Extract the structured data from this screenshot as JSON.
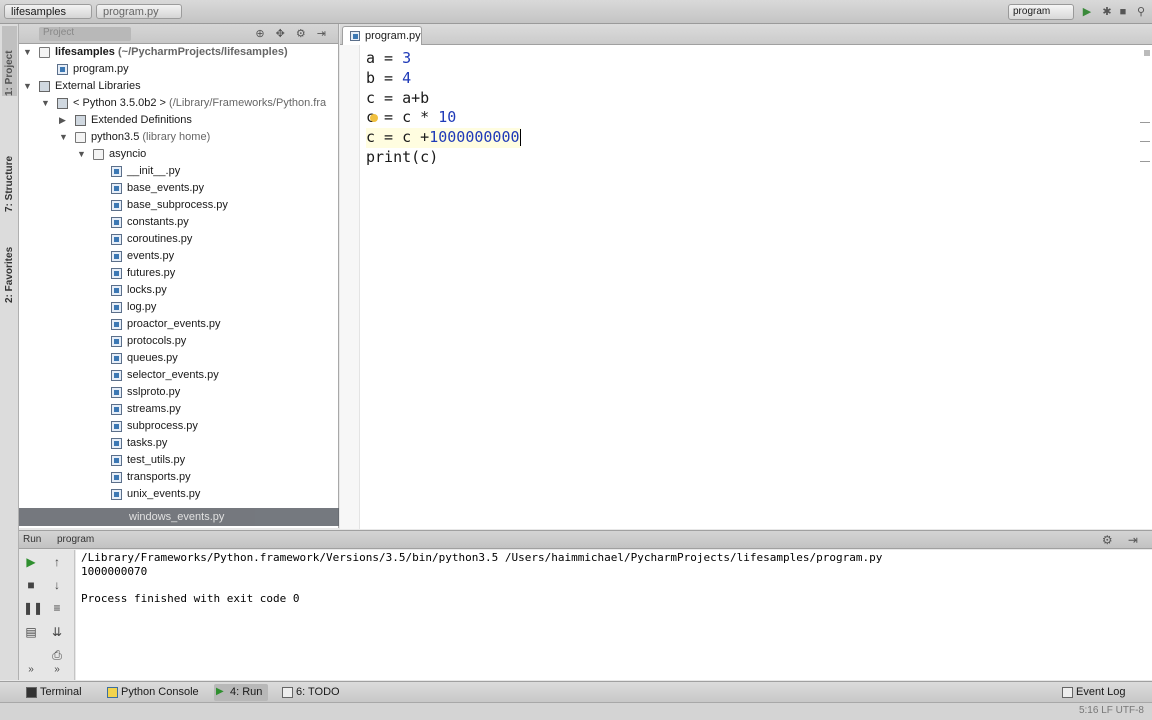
{
  "navbar": {
    "crumb1": "lifesamples",
    "crumb2": "program.py",
    "run_config": "program"
  },
  "left_stripe": {
    "project": "1: Project",
    "structure": "7: Structure",
    "favorites": "2: Favorites"
  },
  "project_panel": {
    "title": "Project",
    "tree": [
      {
        "label": "lifesamples",
        "hint": " (~/PycharmProjects/lifesamples)",
        "bold": true,
        "icon": "folder",
        "depth": 0,
        "arrow": "down"
      },
      {
        "label": "program.py",
        "hint": "",
        "bold": false,
        "icon": "file",
        "depth": 1,
        "arrow": ""
      },
      {
        "label": "External Libraries",
        "hint": "",
        "bold": false,
        "icon": "library",
        "depth": 0,
        "arrow": "down"
      },
      {
        "label": "< Python 3.5.0b2 >",
        "hint": " (/Library/Frameworks/Python.fra",
        "bold": false,
        "icon": "library",
        "depth": 1,
        "arrow": "down"
      },
      {
        "label": "Extended Definitions",
        "hint": "",
        "bold": false,
        "icon": "library",
        "depth": 2,
        "arrow": "right"
      },
      {
        "label": "python3.5",
        "hint": " (library home)",
        "bold": false,
        "icon": "folder",
        "depth": 2,
        "arrow": "down"
      },
      {
        "label": "asyncio",
        "hint": "",
        "bold": false,
        "icon": "folder",
        "depth": 3,
        "arrow": "down"
      },
      {
        "label": "__init__.py",
        "hint": "",
        "bold": false,
        "icon": "file",
        "depth": 4,
        "arrow": ""
      },
      {
        "label": "base_events.py",
        "hint": "",
        "bold": false,
        "icon": "file",
        "depth": 4,
        "arrow": ""
      },
      {
        "label": "base_subprocess.py",
        "hint": "",
        "bold": false,
        "icon": "file",
        "depth": 4,
        "arrow": ""
      },
      {
        "label": "constants.py",
        "hint": "",
        "bold": false,
        "icon": "file",
        "depth": 4,
        "arrow": ""
      },
      {
        "label": "coroutines.py",
        "hint": "",
        "bold": false,
        "icon": "file",
        "depth": 4,
        "arrow": ""
      },
      {
        "label": "events.py",
        "hint": "",
        "bold": false,
        "icon": "file",
        "depth": 4,
        "arrow": ""
      },
      {
        "label": "futures.py",
        "hint": "",
        "bold": false,
        "icon": "file",
        "depth": 4,
        "arrow": ""
      },
      {
        "label": "locks.py",
        "hint": "",
        "bold": false,
        "icon": "file",
        "depth": 4,
        "arrow": ""
      },
      {
        "label": "log.py",
        "hint": "",
        "bold": false,
        "icon": "file",
        "depth": 4,
        "arrow": ""
      },
      {
        "label": "proactor_events.py",
        "hint": "",
        "bold": false,
        "icon": "file",
        "depth": 4,
        "arrow": ""
      },
      {
        "label": "protocols.py",
        "hint": "",
        "bold": false,
        "icon": "file",
        "depth": 4,
        "arrow": ""
      },
      {
        "label": "queues.py",
        "hint": "",
        "bold": false,
        "icon": "file",
        "depth": 4,
        "arrow": ""
      },
      {
        "label": "selector_events.py",
        "hint": "",
        "bold": false,
        "icon": "file",
        "depth": 4,
        "arrow": ""
      },
      {
        "label": "sslproto.py",
        "hint": "",
        "bold": false,
        "icon": "file",
        "depth": 4,
        "arrow": ""
      },
      {
        "label": "streams.py",
        "hint": "",
        "bold": false,
        "icon": "file",
        "depth": 4,
        "arrow": ""
      },
      {
        "label": "subprocess.py",
        "hint": "",
        "bold": false,
        "icon": "file",
        "depth": 4,
        "arrow": ""
      },
      {
        "label": "tasks.py",
        "hint": "",
        "bold": false,
        "icon": "file",
        "depth": 4,
        "arrow": ""
      },
      {
        "label": "test_utils.py",
        "hint": "",
        "bold": false,
        "icon": "file",
        "depth": 4,
        "arrow": ""
      },
      {
        "label": "transports.py",
        "hint": "",
        "bold": false,
        "icon": "file",
        "depth": 4,
        "arrow": ""
      },
      {
        "label": "unix_events.py",
        "hint": "",
        "bold": false,
        "icon": "file",
        "depth": 4,
        "arrow": ""
      }
    ],
    "dragged_item": "windows_events.py"
  },
  "editor": {
    "tab_label": "program.py",
    "lines": [
      [
        {
          "t": "a = ",
          "c": "plain"
        },
        {
          "t": "3",
          "c": "num"
        }
      ],
      [
        {
          "t": "b = ",
          "c": "plain"
        },
        {
          "t": "4",
          "c": "num"
        }
      ],
      [
        {
          "t": "c = a+b",
          "c": "plain"
        }
      ],
      [
        {
          "t": "c = c * ",
          "c": "plain"
        },
        {
          "t": "10",
          "c": "num"
        }
      ],
      [
        {
          "t": "c = c +",
          "c": "plain"
        },
        {
          "t": "1000000000",
          "c": "num"
        }
      ],
      [
        {
          "t": "print(c)",
          "c": "plain"
        }
      ]
    ],
    "active_line": 4,
    "bulb_line": 3
  },
  "run_panel": {
    "label": "Run",
    "config": "program",
    "output": [
      "/Library/Frameworks/Python.framework/Versions/3.5/bin/python3.5 /Users/haimmichael/PycharmProjects/lifesamples/program.py",
      "1000000070",
      "",
      "Process finished with exit code 0"
    ]
  },
  "bottom_tabs": {
    "terminal": "Terminal",
    "python_console": "Python Console",
    "run": "4: Run",
    "todo": "6: TODO",
    "event_log": "Event Log"
  },
  "status": {
    "position": "5:16  LF  UTF-8"
  }
}
